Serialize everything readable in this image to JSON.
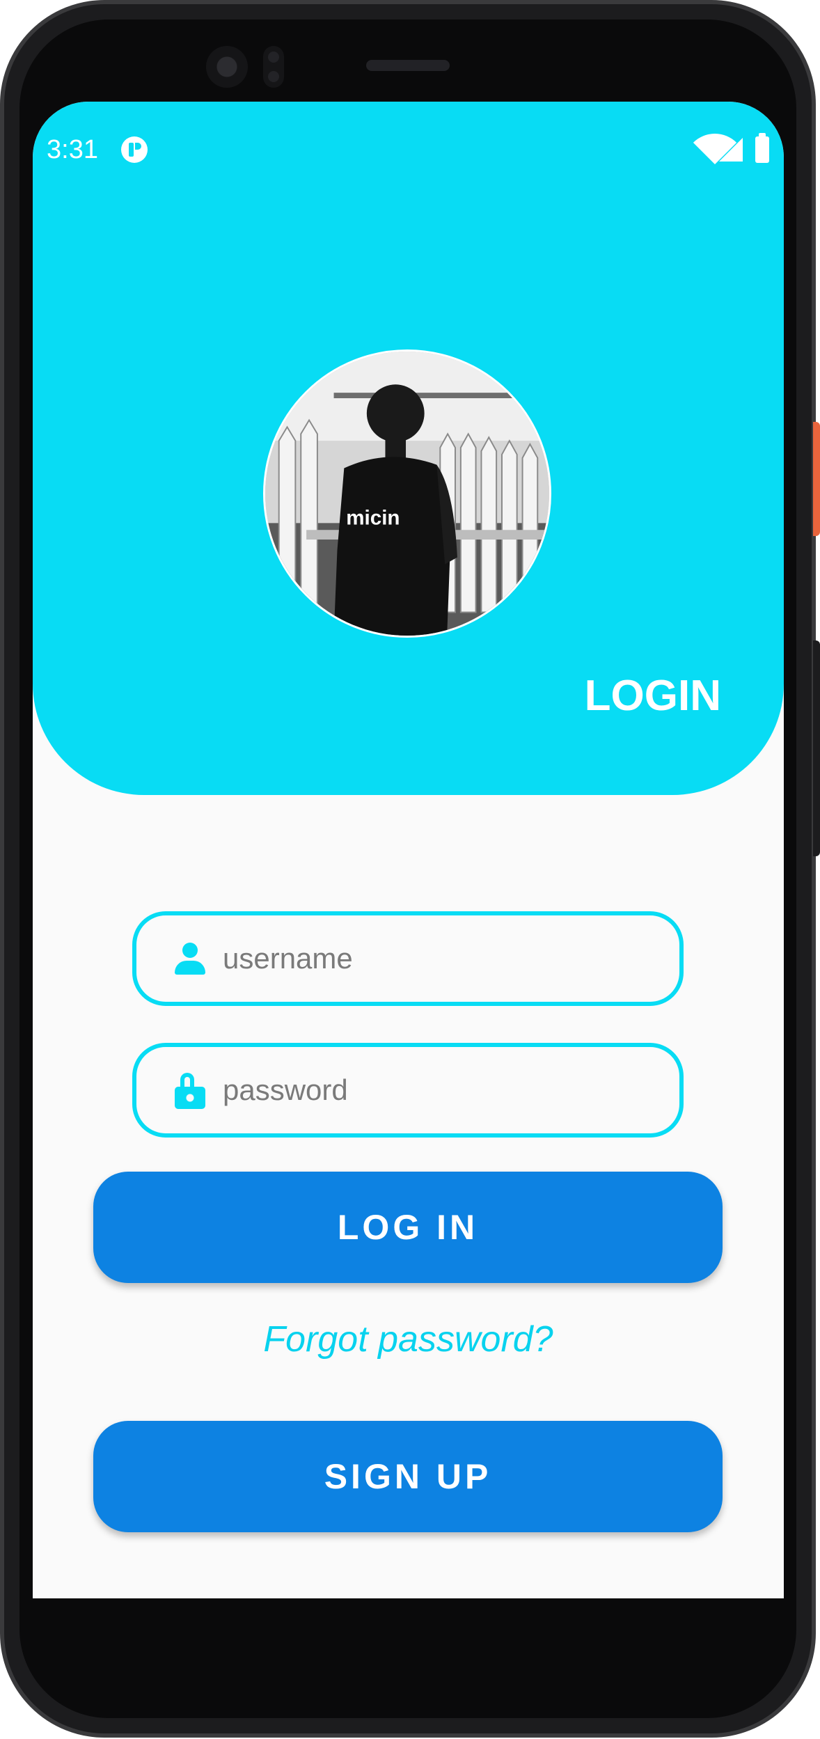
{
  "status_bar": {
    "time": "3:31"
  },
  "header": {
    "title": "LOGIN",
    "avatar_shirt_text": "micin"
  },
  "form": {
    "username_placeholder": "username",
    "password_placeholder": "password",
    "login_label": "LOG IN",
    "forgot_label": "Forgot password?",
    "signup_label": "SIGN UP"
  },
  "colors": {
    "accent": "#08dcf4",
    "button": "#0d82e2",
    "link": "#08d2ee",
    "background": "#fafafa"
  },
  "icons": [
    "app-notification-icon",
    "wifi-icon",
    "signal-icon",
    "battery-icon",
    "person-icon",
    "lock-icon",
    "back-icon",
    "home-icon",
    "recents-icon"
  ]
}
